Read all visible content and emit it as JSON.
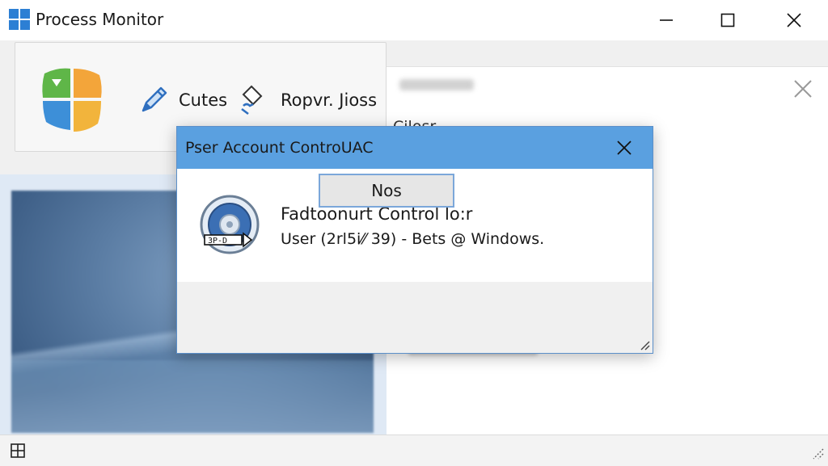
{
  "window": {
    "title": "Process Monitor"
  },
  "toolbar": {
    "cutes_label": "Cutes",
    "report_label": "Ropvr. Jioss"
  },
  "right_pane": {
    "label": "Cjlosr"
  },
  "dialog": {
    "title": "Pser Account ControUAC",
    "heading": "Fadtoonurt Control lo:r",
    "subtext": "User (2rl5i⁄⁄ 39) - Bets @ Windows.",
    "button_label": "Nos"
  },
  "colors": {
    "dialog_titlebar": "#5aa0e0",
    "dialog_border": "#5b8fc9",
    "button_border": "#7ba7da"
  },
  "icons": {
    "app": "process-monitor-logo-icon",
    "tool_cutes": "pencil-icon",
    "tool_report": "eraser-icon",
    "dialog": "shield-disc-icon"
  }
}
